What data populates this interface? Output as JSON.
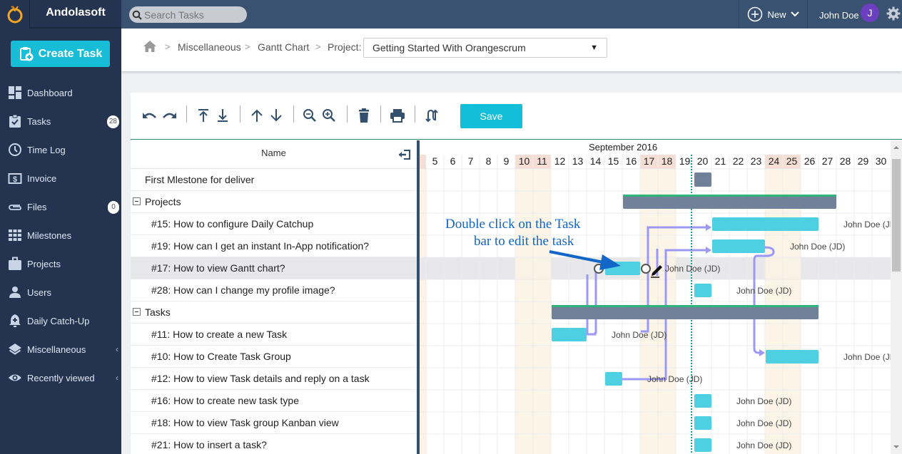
{
  "topbar": {
    "brand": "Andolasoft",
    "search_placeholder": "Search Tasks",
    "new_label": "New",
    "user_name": "John Doe",
    "avatar_initial": "J"
  },
  "sidebar": {
    "create_task_label": "Create Task",
    "items": [
      {
        "label": "Dashboard",
        "icon": "dashboard-icon"
      },
      {
        "label": "Tasks",
        "icon": "tasks-icon",
        "badge": "28"
      },
      {
        "label": "Time Log",
        "icon": "clock-icon"
      },
      {
        "label": "Invoice",
        "icon": "invoice-icon"
      },
      {
        "label": "Files",
        "icon": "paperclip-icon",
        "badge": "0"
      },
      {
        "label": "Milestones",
        "icon": "milestones-icon"
      },
      {
        "label": "Projects",
        "icon": "briefcase-icon"
      },
      {
        "label": "Users",
        "icon": "user-icon"
      },
      {
        "label": "Daily Catch-Up",
        "icon": "bell-plus-icon"
      },
      {
        "label": "Miscellaneous",
        "icon": "layers-icon",
        "chevron": "‹"
      },
      {
        "label": "Recently viewed",
        "icon": "eye-icon",
        "chevron": "‹"
      }
    ]
  },
  "breadcrumb": {
    "items": [
      "Miscellaneous",
      "Gantt Chart"
    ],
    "project_label": "Project:",
    "project_value": "Getting Started With Orangescrum"
  },
  "toolbar": {
    "buttons": [
      "undo",
      "redo",
      "indent-top",
      "indent-bottom",
      "move-up",
      "move-down",
      "zoom-out",
      "zoom-in",
      "delete",
      "print",
      "critical-path"
    ],
    "save_label": "Save"
  },
  "gantt": {
    "name_header": "Name",
    "month_label": "September 2016",
    "days": [
      "5",
      "6",
      "7",
      "8",
      "9",
      "10",
      "11",
      "12",
      "13",
      "14",
      "15",
      "16",
      "17",
      "18",
      "19",
      "20",
      "21",
      "22",
      "23",
      "24",
      "25",
      "26",
      "27",
      "28",
      "29",
      "30"
    ],
    "weekend_days": [
      "10",
      "11",
      "17",
      "18",
      "24",
      "25"
    ],
    "today": "19",
    "annotation_line1": "Double click on the Task",
    "annotation_line2": "bar to edit the task",
    "rows": [
      {
        "name": "First Mlestone for deliver",
        "type": "milestone",
        "indent": 1,
        "start": 20,
        "end": 20,
        "assignee": ""
      },
      {
        "name": "Projects",
        "type": "group",
        "indent": 0,
        "start": 16,
        "end": 27,
        "assignee": ""
      },
      {
        "name": "#15: How to configure Daily Catchup",
        "type": "task",
        "indent": 2,
        "start": 21,
        "end": 26,
        "assignee": "John Doe (JD)"
      },
      {
        "name": "#19: How can I get an instant In-App notification?",
        "type": "task",
        "indent": 2,
        "start": 21,
        "end": 23,
        "assignee": "John Doe (JD)"
      },
      {
        "name": "#17: How to view Gantt chart?",
        "type": "task",
        "indent": 2,
        "start": 15,
        "end": 16,
        "assignee": "John Doe (JD)",
        "selected": true
      },
      {
        "name": "#28: How can I change my profile image?",
        "type": "task",
        "indent": 2,
        "start": 20,
        "end": 20,
        "assignee": "John Doe (JD)"
      },
      {
        "name": "Tasks",
        "type": "group",
        "indent": 0,
        "start": 12,
        "end": 26,
        "assignee": ""
      },
      {
        "name": "#11: How to create a new Task",
        "type": "task",
        "indent": 2,
        "start": 12,
        "end": 13,
        "assignee": "John Doe (JD)"
      },
      {
        "name": "#10: How to Create Task Group",
        "type": "task",
        "indent": 2,
        "start": 24,
        "end": 26,
        "assignee": "John Doe (JD)"
      },
      {
        "name": "#12: How to view Task details and reply on a task",
        "type": "task",
        "indent": 2,
        "start": 15,
        "end": 15,
        "assignee": "John Doe (JD)"
      },
      {
        "name": "#16: How to create new task type",
        "type": "task",
        "indent": 2,
        "start": 20,
        "end": 20,
        "assignee": "John Doe (JD)"
      },
      {
        "name": "#18: How to view Task group Kanban view",
        "type": "task",
        "indent": 2,
        "start": 20,
        "end": 20,
        "assignee": "John Doe (JD)"
      },
      {
        "name": "#21: How to insert a task?",
        "type": "task",
        "indent": 2,
        "start": 20,
        "end": 20,
        "assignee": "John Doe (JD)"
      }
    ]
  },
  "colors": {
    "task_bar": "#4fd0e2",
    "group_bar": "#72819a",
    "group_progress": "#2fb37a",
    "link": "#9c98f5",
    "weekend_header": "#f5ded6",
    "weekend_col": "#fdf3e6",
    "today_marker": "#1a9f98",
    "annotation": "#1166c8"
  }
}
